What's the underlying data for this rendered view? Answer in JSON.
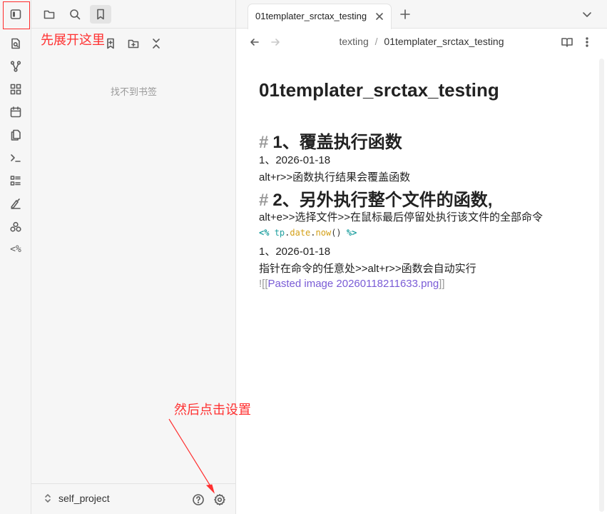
{
  "sidebar": {
    "empty_message": "找不到书签",
    "vault_name": "self_project"
  },
  "tab": {
    "title": "01templater_srctax_testing"
  },
  "breadcrumb": {
    "folder": "texting",
    "separator": "/",
    "file": "01templater_srctax_testing"
  },
  "document": {
    "title": "01templater_srctax_testing",
    "h1_1": "1、覆盖执行函数",
    "date_1": "1、2026-01-18",
    "alt_r": "alt+r>>函数执行结果会覆盖函数",
    "h1_2": "2、另外执行整个文件的函数,",
    "alt_e": "alt+e>>选择文件>>在鼠标最后停留处执行该文件的全部命令",
    "code_open": "<%",
    "code_obj": "tp",
    "code_dot1": ".",
    "code_prop": "date",
    "code_dot2": ".",
    "code_fn": "now",
    "code_paren": "()",
    "code_close": "%>",
    "date_2": "1、2026-01-18",
    "cursor_line": "指针在命令的任意处>>alt+r>>函数会自动实行",
    "embed_open": "![[",
    "embed_name": "Pasted image 20260118211633.png",
    "embed_close": "]]",
    "hash_symbol": "#"
  },
  "annotations": {
    "expand_hint": "先展开这里",
    "settings_hint": "然后点击设置"
  },
  "ribbon": {
    "templater_label": "<%"
  },
  "icons": {
    "ribbon": [
      "sidebar-toggle-icon",
      "search-file-icon",
      "graph-icon",
      "canvas-icon",
      "calendar-icon",
      "pages-icon",
      "terminal-icon",
      "list-icon",
      "signature-icon",
      "bases-icon",
      "templater-icon"
    ],
    "sidebar_tabs": [
      "folder-icon",
      "search-icon",
      "bookmark-icon"
    ],
    "sidebar_actions": [
      "bookmark-add-icon",
      "folder-add-icon",
      "collapse-icon"
    ],
    "vault": [
      "chevrons-updown-icon",
      "help-icon",
      "gear-icon"
    ]
  },
  "colors": {
    "annotation": "#ff3030",
    "code_tag": "#20a0a0",
    "code_keyword": "#d4a017",
    "embed_link": "#7a5cd6"
  }
}
